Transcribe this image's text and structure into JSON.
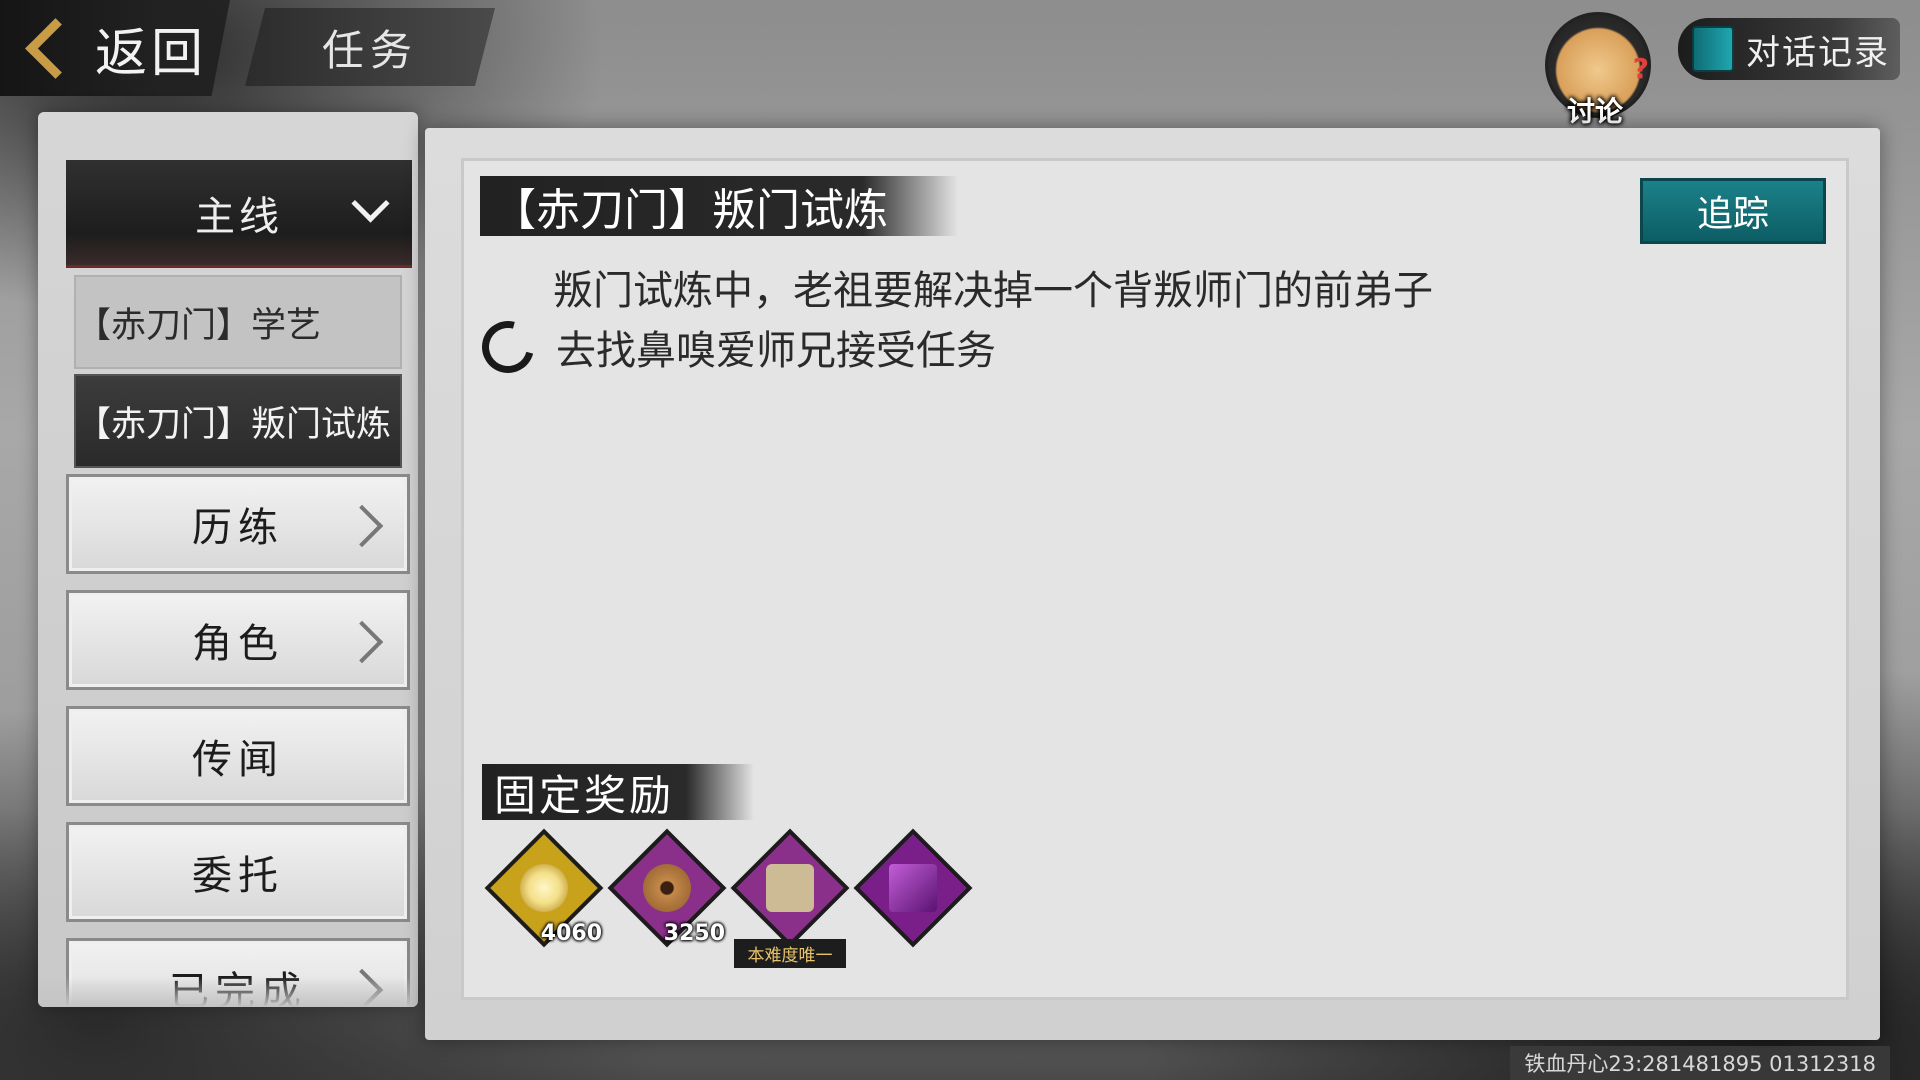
{
  "header": {
    "back_label": "返回",
    "title": "任务",
    "discuss_label": "讨论",
    "dialog_log_label": "对话记录"
  },
  "sidebar": {
    "main_category": "主线",
    "sub_items": [
      {
        "label": "【赤刀门】学艺",
        "state": "inactive"
      },
      {
        "label": "【赤刀门】叛门试炼",
        "state": "active"
      }
    ],
    "categories": [
      {
        "label": "历练",
        "has_arrow": true
      },
      {
        "label": "角色",
        "has_arrow": true
      },
      {
        "label": "传闻",
        "has_arrow": false
      },
      {
        "label": "委托",
        "has_arrow": false
      },
      {
        "label": "已完成",
        "has_arrow": true
      }
    ]
  },
  "quest": {
    "title": "【赤刀门】叛门试炼",
    "track_label": "追踪",
    "description": "叛门试炼中，老祖要解决掉一个背叛师门的前弟子",
    "objective": "去找鼻嗅爱师兄接受任务"
  },
  "rewards": {
    "header": "固定奖励",
    "items": [
      {
        "icon": "gold-orb-icon",
        "count": "4060",
        "frame_color": "#c9a21c",
        "core_color": "#f4e08a"
      },
      {
        "icon": "copper-coin-icon",
        "count": "3250",
        "frame_color": "#8a2f8a",
        "core_color": "#c4884a"
      },
      {
        "icon": "inner-skill-scroll-icon",
        "count": "",
        "tag": "本难度唯一",
        "frame_color": "#8a2f8a",
        "core_color": "#cdbb95"
      },
      {
        "icon": "purple-book-icon",
        "count": "",
        "frame_color": "#7a1f8a",
        "core_color": "#8e2fb0"
      }
    ]
  },
  "footer": {
    "watermark": "铁血丹心23:281481895 01312318"
  },
  "colors": {
    "accent_teal": "#1b8189",
    "gold": "#c89b45"
  }
}
